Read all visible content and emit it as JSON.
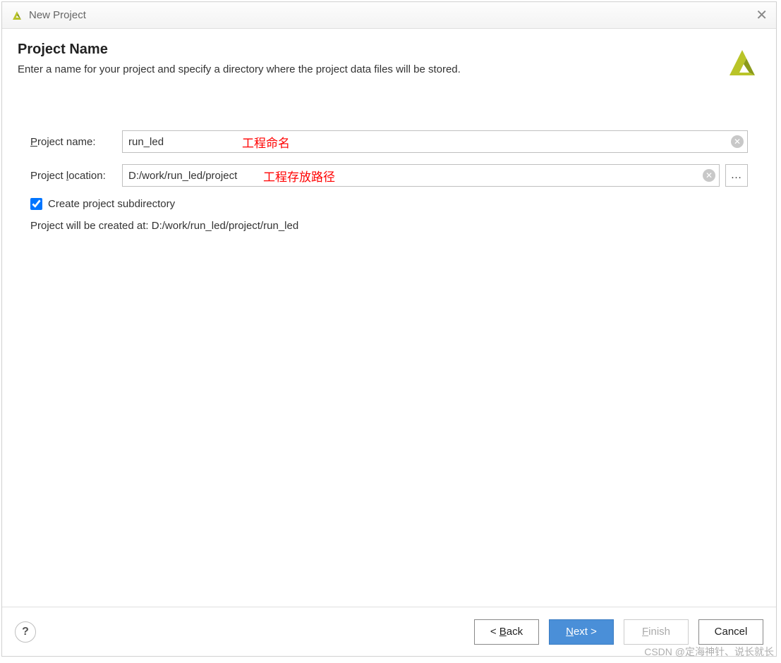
{
  "window": {
    "title": "New Project"
  },
  "header": {
    "title": "Project Name",
    "subtitle": "Enter a name for your project and specify a directory where the project data files will be stored."
  },
  "form": {
    "name_label": "Project name:",
    "name_value": "run_led",
    "name_annotation": "工程命名",
    "location_label": "Project location:",
    "location_value": "D:/work/run_led/project",
    "location_annotation": "工程存放路径",
    "browse_label": "…",
    "subdir_checked": true,
    "subdir_label": "Create project subdirectory",
    "created_at_label": "Project will be created at: D:/work/run_led/project/run_led"
  },
  "footer": {
    "help": "?",
    "back": "< Back",
    "next": "Next >",
    "finish": "Finish",
    "cancel": "Cancel"
  },
  "watermark": "CSDN @定海神针、说长就长"
}
